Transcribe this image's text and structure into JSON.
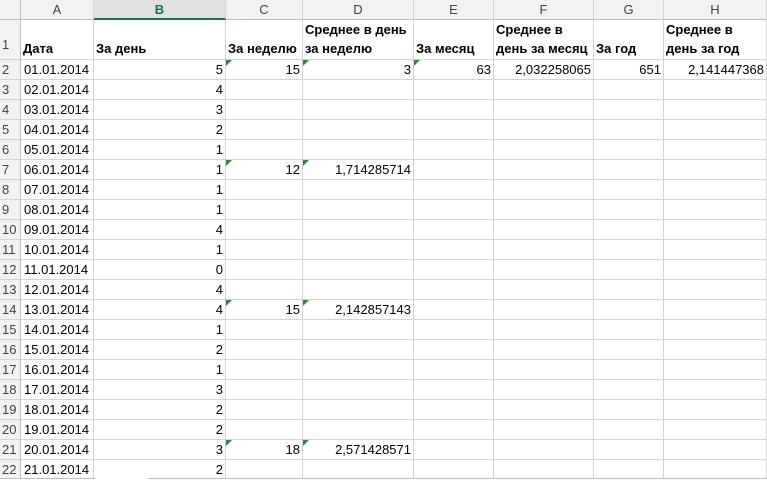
{
  "columns": [
    "A",
    "B",
    "C",
    "D",
    "E",
    "F",
    "G",
    "H"
  ],
  "selected_column": "B",
  "header_row": {
    "row_number": "1",
    "A": "Дата",
    "B": "За день",
    "C": "За неделю",
    "D": "Среднее в день за неделю",
    "E": "За месяц",
    "F": "Среднее в день за месяц",
    "G": "За год",
    "H": "Среднее в день за год"
  },
  "rows": [
    {
      "n": "2",
      "A": "01.01.2014",
      "B": "5",
      "C": "15",
      "D": "3",
      "E": "63",
      "F": "2,032258065",
      "G": "651",
      "H": "2,141447368"
    },
    {
      "n": "3",
      "A": "02.01.2014",
      "B": "4"
    },
    {
      "n": "4",
      "A": "03.01.2014",
      "B": "3"
    },
    {
      "n": "5",
      "A": "04.01.2014",
      "B": "2"
    },
    {
      "n": "6",
      "A": "05.01.2014",
      "B": "1"
    },
    {
      "n": "7",
      "A": "06.01.2014",
      "B": "1",
      "C": "12",
      "D": "1,714285714"
    },
    {
      "n": "8",
      "A": "07.01.2014",
      "B": "1"
    },
    {
      "n": "9",
      "A": "08.01.2014",
      "B": "1"
    },
    {
      "n": "10",
      "A": "09.01.2014",
      "B": "4"
    },
    {
      "n": "11",
      "A": "10.01.2014",
      "B": "1"
    },
    {
      "n": "12",
      "A": "11.01.2014",
      "B": "0"
    },
    {
      "n": "13",
      "A": "12.01.2014",
      "B": "4"
    },
    {
      "n": "14",
      "A": "13.01.2014",
      "B": "4",
      "C": "15",
      "D": "2,142857143"
    },
    {
      "n": "15",
      "A": "14.01.2014",
      "B": "1"
    },
    {
      "n": "16",
      "A": "15.01.2014",
      "B": "2"
    },
    {
      "n": "17",
      "A": "16.01.2014",
      "B": "1"
    },
    {
      "n": "18",
      "A": "17.01.2014",
      "B": "3"
    },
    {
      "n": "19",
      "A": "18.01.2014",
      "B": "2"
    },
    {
      "n": "20",
      "A": "19.01.2014",
      "B": "2"
    },
    {
      "n": "21",
      "A": "20.01.2014",
      "B": "3",
      "C": "18",
      "D": "2,571428571"
    },
    {
      "n": "22",
      "A": "21.01.2014",
      "B": "2"
    }
  ],
  "formula_indicator_color": "#1e8e3e",
  "selected_header_color": "#217346"
}
